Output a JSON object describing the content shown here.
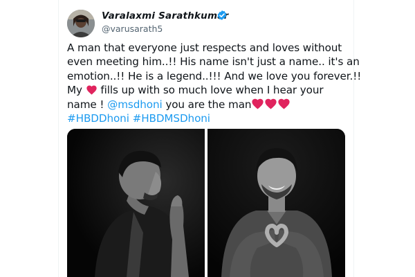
{
  "tweet": {
    "author": {
      "display_name": "Varalaxmi Sarathkumar",
      "handle": "@varusarath5",
      "verified": true,
      "verified_icon": "verified-badge-icon",
      "verified_color": "#1d9bf0"
    },
    "body": {
      "line1": "A man that everyone just respects and loves without",
      "line2": "even meeting him..!! His name isn't just a name.. it's an",
      "line3": "emotion..!! He is a legend..!!! And we love you forever.!!",
      "line4_before": "My ",
      "line4_after": " fills up with so much love when I hear your",
      "line5_before": "name ! ",
      "mention": "@msdhoni",
      "line5_after": " you are the man",
      "hashtag1": "#HBDDhoni",
      "hashtag2": "#HBDMSDhoni"
    },
    "colors": {
      "link": "#1d9bf0",
      "heart": "#e0245e",
      "text": "#0f1419",
      "secondary": "#536471"
    },
    "media": [
      {
        "icon": "photo-dhoni-side-profile"
      },
      {
        "icon": "photo-dhoni-heart-hands"
      }
    ]
  }
}
